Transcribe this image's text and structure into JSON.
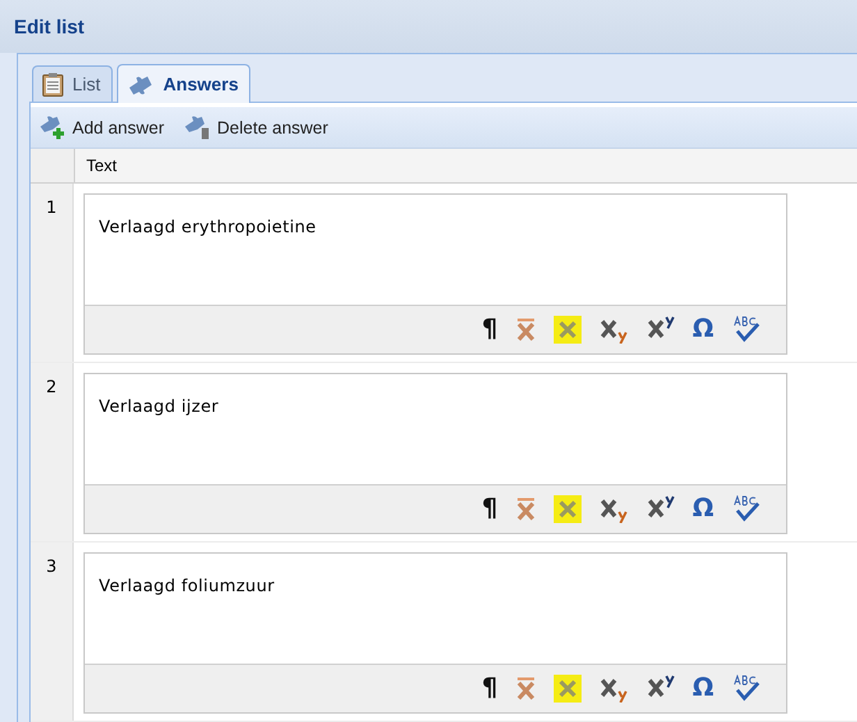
{
  "window": {
    "title": "Edit list"
  },
  "tabs": [
    {
      "label": "List",
      "selected": false,
      "kind": "list"
    },
    {
      "label": "Answers",
      "selected": true,
      "kind": "answers"
    }
  ],
  "toolbar": [
    {
      "label": "Add answer",
      "kind": "add"
    },
    {
      "label": "Delete answer",
      "kind": "delete"
    }
  ],
  "table": {
    "columns": [
      "Text"
    ],
    "rows": [
      {
        "number": "1",
        "text": "Verlaagd erythropoietine",
        "tools": [
          {
            "kind": "pilcrow",
            "glyph": "¶"
          },
          {
            "kind": "remove-format"
          },
          {
            "kind": "highlight"
          },
          {
            "kind": "subscript"
          },
          {
            "kind": "superscript"
          },
          {
            "kind": "omega",
            "glyph": "Ω"
          },
          {
            "kind": "spellcheck"
          }
        ]
      },
      {
        "number": "2",
        "text": "Verlaagd ijzer",
        "tools": [
          {
            "kind": "pilcrow",
            "glyph": "¶"
          },
          {
            "kind": "remove-format"
          },
          {
            "kind": "highlight"
          },
          {
            "kind": "subscript"
          },
          {
            "kind": "superscript"
          },
          {
            "kind": "omega",
            "glyph": "Ω"
          },
          {
            "kind": "spellcheck"
          }
        ]
      },
      {
        "number": "3",
        "text": "Verlaagd foliumzuur",
        "tools": [
          {
            "kind": "pilcrow",
            "glyph": "¶"
          },
          {
            "kind": "remove-format"
          },
          {
            "kind": "highlight"
          },
          {
            "kind": "subscript"
          },
          {
            "kind": "superscript"
          },
          {
            "kind": "omega",
            "glyph": "Ω"
          },
          {
            "kind": "spellcheck"
          }
        ]
      }
    ]
  }
}
